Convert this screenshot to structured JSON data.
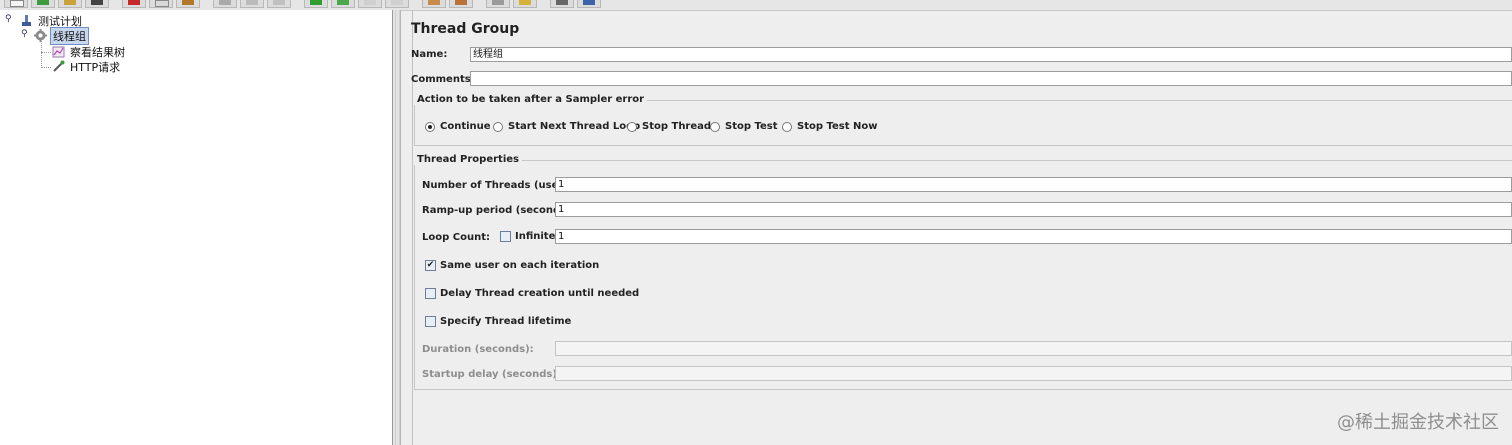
{
  "tree": {
    "root": {
      "label": "测试计划",
      "icon": "test-plan-icon"
    },
    "thread_group": {
      "label": "线程组",
      "icon": "thread-group-gear-icon"
    },
    "children": [
      {
        "label": "察看结果树",
        "icon": "results-tree-chart-icon"
      },
      {
        "label": "HTTP请求",
        "icon": "http-sampler-pipette-icon"
      }
    ]
  },
  "panel": {
    "title": "Thread Group",
    "name_label": "Name:",
    "name_value": "线程组",
    "comments_label": "Comments:",
    "comments_value": "",
    "sampler_error": {
      "legend": "Action to be taken after a Sampler error",
      "options": [
        "Continue",
        "Start Next Thread Loop",
        "Stop Thread",
        "Stop Test",
        "Stop Test Now"
      ],
      "selected": "Continue"
    },
    "thread_props": {
      "legend": "Thread Properties",
      "num_threads_label": "Number of Threads (users):",
      "num_threads_value": "1",
      "rampup_label": "Ramp-up period (seconds):",
      "rampup_value": "1",
      "loop_label": "Loop Count:",
      "infinite_label": "Infinite",
      "infinite_checked": false,
      "loop_value": "1",
      "same_user_label": "Same user on each iteration",
      "same_user_checked": true,
      "delay_label": "Delay Thread creation until needed",
      "delay_checked": false,
      "lifetime_label": "Specify Thread lifetime",
      "lifetime_checked": false,
      "duration_label": "Duration (seconds):",
      "duration_value": "",
      "startup_delay_label": "Startup delay (seconds):",
      "startup_delay_value": ""
    }
  },
  "watermark": "@稀土掘金技术社区"
}
